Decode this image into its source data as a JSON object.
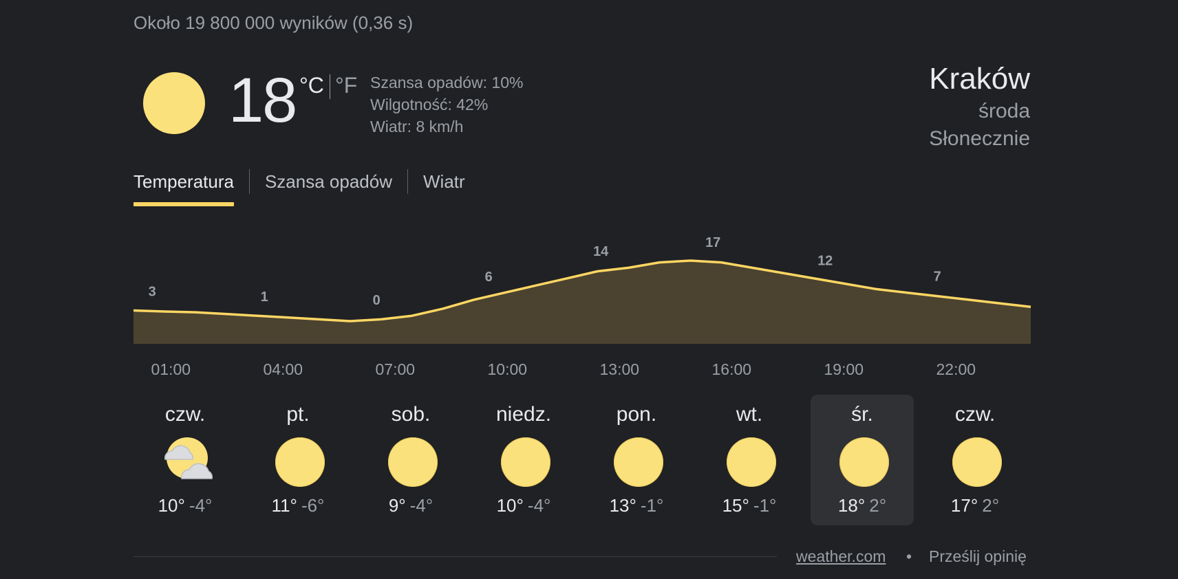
{
  "results_stats": "Około 19 800 000 wyników (0,36 s)",
  "current": {
    "icon": "sun-icon",
    "temperature": "18",
    "unit_c": "°C",
    "unit_f": "°F",
    "precipitation": "Szansa opadów: 10%",
    "humidity": "Wilgotność: 42%",
    "wind": "Wiatr: 8 km/h"
  },
  "location": {
    "city": "Kraków",
    "day": "środa",
    "condition": "Słonecznie"
  },
  "tabs": [
    {
      "label": "Temperatura",
      "active": true
    },
    {
      "label": "Szansa opadów",
      "active": false
    },
    {
      "label": "Wiatr",
      "active": false
    }
  ],
  "colors": {
    "accent": "#fdd663",
    "area_fill": "#4b4330",
    "sun": "#fbe17c",
    "background": "#202124"
  },
  "chart_data": {
    "type": "area",
    "x": [
      "00:00",
      "01:00",
      "02:00",
      "03:00",
      "04:00",
      "05:00",
      "06:00",
      "07:00",
      "08:00",
      "09:00",
      "10:00",
      "11:00",
      "12:00",
      "13:00",
      "14:00",
      "15:00",
      "16:00",
      "17:00",
      "18:00",
      "19:00",
      "20:00",
      "21:00",
      "22:00",
      "23:00",
      "24:00"
    ],
    "values": [
      3,
      2.7,
      2.5,
      2,
      1.5,
      1,
      0.5,
      0,
      0.5,
      1.5,
      3.5,
      6,
      8,
      10,
      12,
      14,
      15,
      16.5,
      17,
      16.5,
      15,
      13.5,
      12,
      10.5,
      9,
      8,
      7,
      6,
      5,
      4
    ],
    "point_labels": [
      {
        "hour": "00:30",
        "label": "3"
      },
      {
        "hour": "03:30",
        "label": "1"
      },
      {
        "hour": "06:30",
        "label": "0"
      },
      {
        "hour": "09:30",
        "label": "6"
      },
      {
        "hour": "12:30",
        "label": "14"
      },
      {
        "hour": "15:30",
        "label": "17"
      },
      {
        "hour": "18:30",
        "label": "12"
      },
      {
        "hour": "21:30",
        "label": "7"
      }
    ],
    "hour_ticks": [
      "01:00",
      "04:00",
      "07:00",
      "10:00",
      "13:00",
      "16:00",
      "19:00",
      "22:00"
    ],
    "grid": false
  },
  "forecast": [
    {
      "day": "czw.",
      "icon": "partly-cloudy-icon",
      "max": "10°",
      "min": "-4°",
      "selected": false
    },
    {
      "day": "pt.",
      "icon": "sun-icon",
      "max": "11°",
      "min": "-6°",
      "selected": false
    },
    {
      "day": "sob.",
      "icon": "sun-icon",
      "max": "9°",
      "min": "-4°",
      "selected": false
    },
    {
      "day": "niedz.",
      "icon": "sun-icon",
      "max": "10°",
      "min": "-4°",
      "selected": false
    },
    {
      "day": "pon.",
      "icon": "sun-icon",
      "max": "13°",
      "min": "-1°",
      "selected": false
    },
    {
      "day": "wt.",
      "icon": "sun-icon",
      "max": "15°",
      "min": "-1°",
      "selected": false
    },
    {
      "day": "śr.",
      "icon": "sun-icon",
      "max": "18°",
      "min": "2°",
      "selected": true
    },
    {
      "day": "czw.",
      "icon": "sun-icon",
      "max": "17°",
      "min": "2°",
      "selected": false
    }
  ],
  "footer": {
    "source": "weather.com",
    "separator": "•",
    "feedback": "Prześlij opinię"
  }
}
